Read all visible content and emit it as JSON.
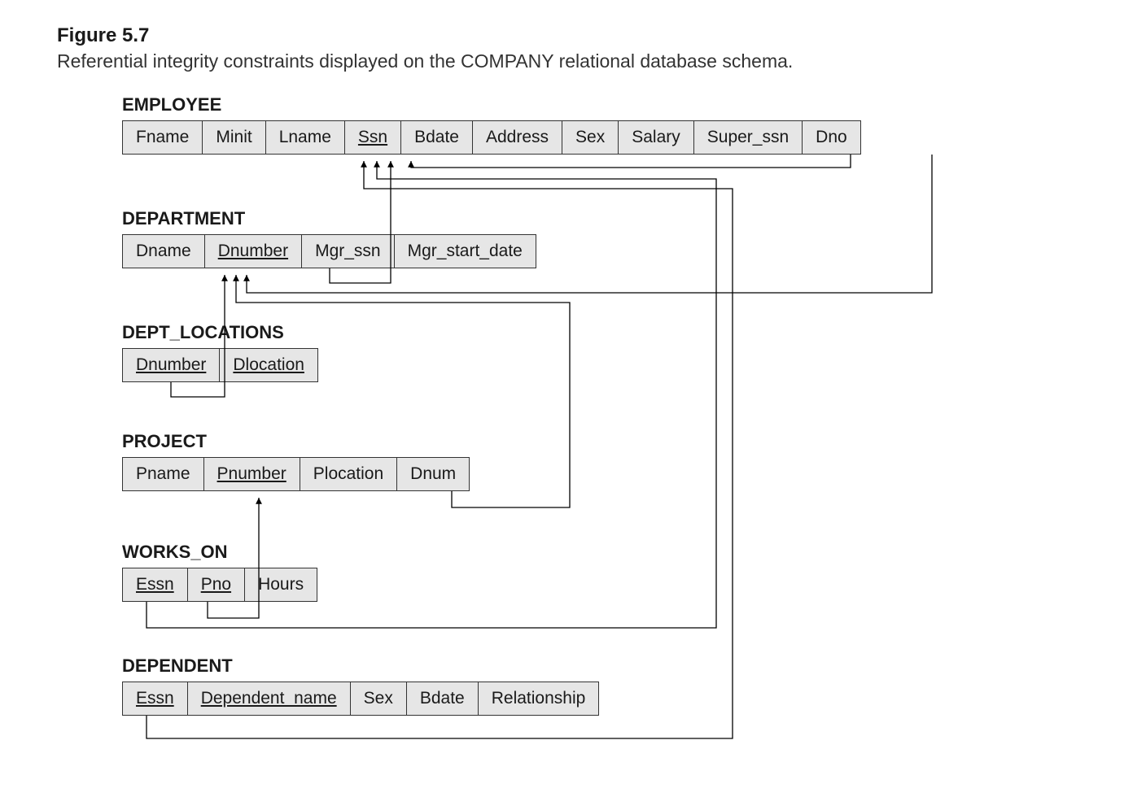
{
  "figure_label": "Figure 5.7",
  "figure_caption": "Referential integrity constraints displayed on the COMPANY relational database schema.",
  "relations": {
    "employee": {
      "title": "EMPLOYEE",
      "cols": [
        "Fname",
        "Minit",
        "Lname",
        "Ssn",
        "Bdate",
        "Address",
        "Sex",
        "Salary",
        "Super_ssn",
        "Dno"
      ]
    },
    "department": {
      "title": "DEPARTMENT",
      "cols": [
        "Dname",
        "Dnumber",
        "Mgr_ssn",
        "Mgr_start_date"
      ]
    },
    "dept_locations": {
      "title": "DEPT_LOCATIONS",
      "cols": [
        "Dnumber",
        "Dlocation"
      ]
    },
    "project": {
      "title": "PROJECT",
      "cols": [
        "Pname",
        "Pnumber",
        "Plocation",
        "Dnum"
      ]
    },
    "works_on": {
      "title": "WORKS_ON",
      "cols": [
        "Essn",
        "Pno",
        "Hours"
      ]
    },
    "dependent": {
      "title": "DEPENDENT",
      "cols": [
        "Essn",
        "Dependent_name",
        "Sex",
        "Bdate",
        "Relationship"
      ]
    }
  },
  "primary_keys": {
    "employee": [
      "Ssn"
    ],
    "department": [
      "Dnumber"
    ],
    "dept_locations": [
      "Dnumber",
      "Dlocation"
    ],
    "project": [
      "Pnumber"
    ],
    "works_on": [
      "Essn",
      "Pno"
    ],
    "dependent": [
      "Essn",
      "Dependent_name"
    ]
  },
  "foreign_keys": [
    {
      "from": "EMPLOYEE.Super_ssn",
      "to": "EMPLOYEE.Ssn"
    },
    {
      "from": "EMPLOYEE.Dno",
      "to": "DEPARTMENT.Dnumber"
    },
    {
      "from": "DEPARTMENT.Mgr_ssn",
      "to": "EMPLOYEE.Ssn"
    },
    {
      "from": "DEPT_LOCATIONS.Dnumber",
      "to": "DEPARTMENT.Dnumber"
    },
    {
      "from": "PROJECT.Dnum",
      "to": "DEPARTMENT.Dnumber"
    },
    {
      "from": "WORKS_ON.Essn",
      "to": "EMPLOYEE.Ssn"
    },
    {
      "from": "WORKS_ON.Pno",
      "to": "PROJECT.Pnumber"
    },
    {
      "from": "DEPENDENT.Essn",
      "to": "EMPLOYEE.Ssn"
    }
  ]
}
